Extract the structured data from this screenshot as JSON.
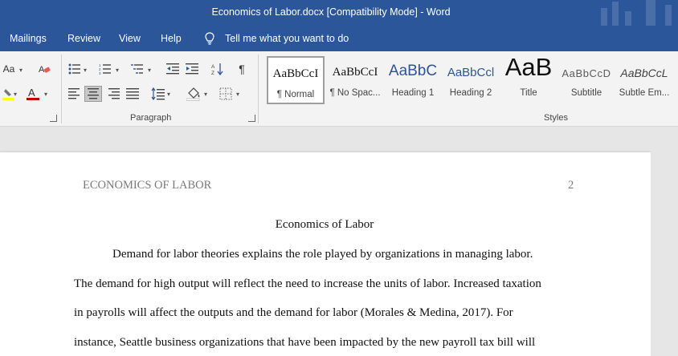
{
  "window": {
    "title": "Economics of Labor.docx [Compatibility Mode]  -  Word"
  },
  "menu": {
    "tabs": [
      "Mailings",
      "Review",
      "View",
      "Help"
    ],
    "tell_me": "Tell me what you want to do"
  },
  "ribbon": {
    "font_group": {
      "change_case": "Aa",
      "font_color": "#c00000",
      "highlight_color": "#ffff00"
    },
    "paragraph_group": {
      "label": "Paragraph"
    },
    "styles_group": {
      "label": "Styles",
      "items": [
        {
          "sample": "AaBbCcI",
          "name": "¶ Normal"
        },
        {
          "sample": "AaBbCcI",
          "name": "¶ No Spac..."
        },
        {
          "sample": "AaBbC",
          "name": "Heading 1"
        },
        {
          "sample": "AaBbCcl",
          "name": "Heading 2"
        },
        {
          "sample": "AaB",
          "name": "Title"
        },
        {
          "sample": "AaBbCcD",
          "name": "Subtitle"
        },
        {
          "sample": "AaBbCcL",
          "name": "Subtle Em..."
        }
      ]
    }
  },
  "document": {
    "running_head": "ECONOMICS OF LABOR",
    "page_number": "2",
    "title": "Economics of Labor",
    "lines": [
      "Demand for labor theories explains the role played by organizations in managing labor.",
      "The demand for high output will reflect the need to increase the units of labor. Increased taxation",
      "in payrolls will affect the outputs and the demand for labor (Morales & Medina, 2017). For",
      "instance, Seattle business organizations that have been impacted by the new payroll tax bill will"
    ]
  },
  "colors": {
    "accent": "#2b579a",
    "ribbon_bg": "#f3f3f3",
    "canvas_bg": "#e6e6e6",
    "heading_blue": "#2f5496"
  }
}
